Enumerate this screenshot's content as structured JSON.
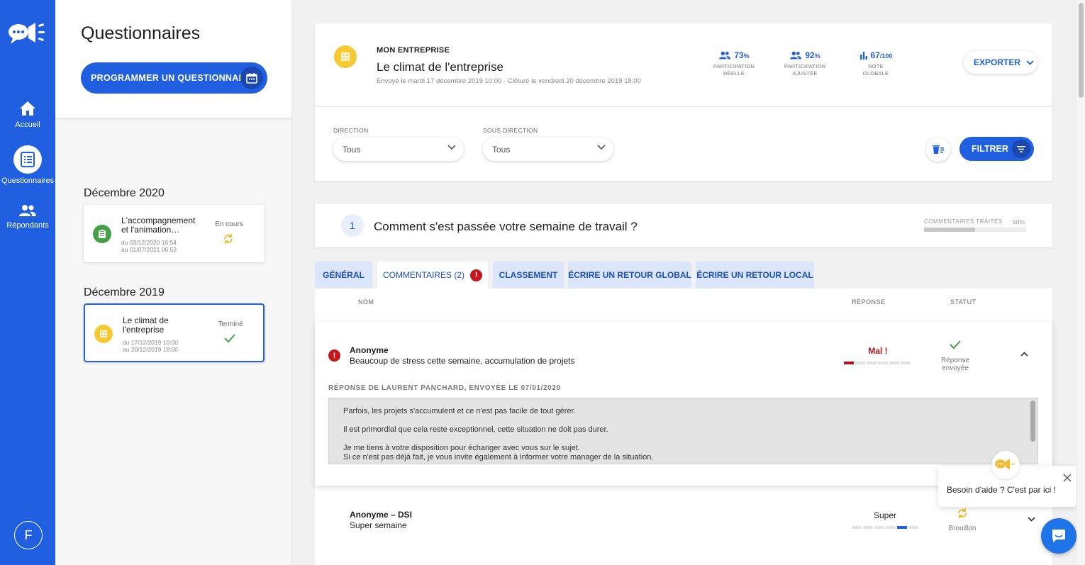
{
  "rail": {
    "items": [
      {
        "label": "Accueil",
        "icon": "home-icon"
      },
      {
        "label": "Questionnaires",
        "icon": "list-icon"
      },
      {
        "label": "Répondants",
        "icon": "people-icon"
      }
    ],
    "avatar": "F"
  },
  "list": {
    "title": "Questionnaires",
    "program_button": "PROGRAMMER UN QUESTIONNAIRE",
    "groups": [
      {
        "month": "Décembre 2020",
        "card": {
          "title": "L'accompagnement et l'animation…",
          "date_from": "du 03/12/2020 16:54",
          "date_to": "au 01/07/2021 06:53",
          "status": "En cours",
          "icon": "clipboard-icon",
          "icon_color": "#43a047"
        }
      },
      {
        "month": "Décembre 2019",
        "card": {
          "title": "Le climat de l'entreprise",
          "date_from": "du 17/12/2019 10:00",
          "date_to": "au 20/12/2019 18:00",
          "status": "Terminé",
          "icon": "building-icon",
          "icon_color": "#f7c933"
        }
      }
    ]
  },
  "header": {
    "company": "MON ENTREPRISE",
    "title": "Le climat de l'entreprise",
    "subtitle": "Envoyé le mardi 17 décembre 2019 10:00 - Clôturé le vendredi 20 décembre 2019 18:00",
    "stats": [
      {
        "value": "73",
        "unit": "%",
        "label_1": "PARTICIPATION",
        "label_2": "RÉELLE",
        "icon": "people-icon"
      },
      {
        "value": "92",
        "unit": "%",
        "label_1": "PARTICIPATION",
        "label_2": "AJUSTÉE",
        "icon": "people-icon"
      },
      {
        "value": "67",
        "unit": "/100",
        "label_1": "NOTE",
        "label_2": "GLOBALE",
        "icon": "bar-chart-icon"
      }
    ],
    "export_button": "EXPORTER"
  },
  "filters": {
    "direction_label": "DIRECTION",
    "direction_value": "Tous",
    "sous_direction_label": "SOUS DIRECTION",
    "sous_direction_value": "Tous",
    "filter_button": "FILTRER"
  },
  "question": {
    "number": "1",
    "text": "Comment s'est passée votre semaine de travail ?",
    "processed_label": "COMMENTAIRES TRAITÉS",
    "processed_pct": "50%",
    "processed_value": 0.5
  },
  "tabs": [
    {
      "label": "GÉNÉRAL"
    },
    {
      "label": "COMMENTAIRES (2)",
      "badge": "!"
    },
    {
      "label": "CLASSEMENT"
    },
    {
      "label": "ÉCRIRE UN RETOUR GLOBAL"
    },
    {
      "label": "ÉCRIRE UN RETOUR LOCAL"
    }
  ],
  "table": {
    "col_name": "NOM",
    "col_response": "RÉPONSE",
    "col_status": "STATUT",
    "rows": [
      {
        "name": "Anonyme",
        "comment": "Beaucoup de stress cette semaine, accumulation de projets",
        "response": "Mal !",
        "response_color": "#b3151b",
        "scale_level": 1,
        "status_1": "Réponse",
        "status_2": "envoyée",
        "alert": "!"
      },
      {
        "name": "Anonyme – DSI",
        "comment": "Super semaine",
        "response": "Super",
        "response_color": "#1d1d1d",
        "scale_level": 5,
        "status_1": "Brouillon"
      }
    ],
    "reply": {
      "label": "RÉPONSE DE LAURENT PANCHARD, ENVOYÉE LE 07/01/2020",
      "lines": [
        "Parfois, les projets s'accumulent et ce n'est pas facile de tout gérer.",
        "Il est primordial que cela reste exceptionnel, cette situation ne doit pas durer.",
        "Je me tiens à votre disposition pour échanger avec vous sur le sujet.",
        "Si ce n'est pas déjà fait, je vous invite également à informer votre manager de la situation."
      ]
    }
  },
  "help": {
    "text": "Besoin d'aide ? C'est par ici !"
  },
  "colors": {
    "primary": "#1f5fe0",
    "danger": "#c4161c",
    "success": "#43a047",
    "warning": "#f5b82e"
  }
}
